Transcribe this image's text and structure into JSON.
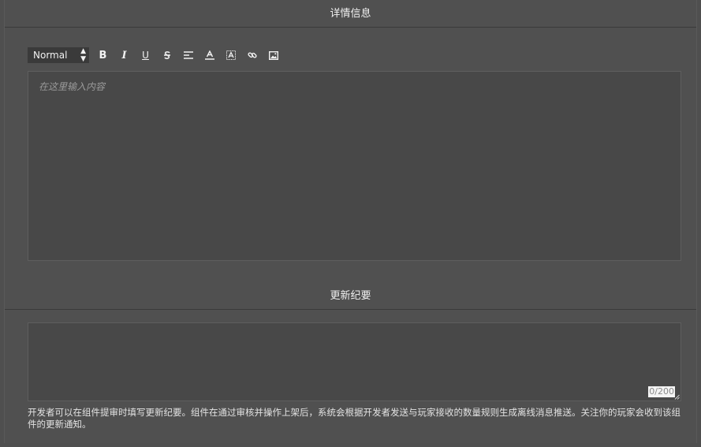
{
  "details": {
    "title": "详情信息",
    "format_select": "Normal",
    "placeholder": "在这里输入内容"
  },
  "toolbar": {
    "icons": [
      "bold-icon",
      "italic-icon",
      "underline-icon",
      "strikethrough-icon",
      "align-icon",
      "font-color-icon",
      "background-color-icon",
      "link-icon",
      "image-icon"
    ],
    "bold_label": "B",
    "italic_label": "I",
    "underline_label": "U"
  },
  "changelog": {
    "title": "更新纪要",
    "value": "",
    "counter": "0/200",
    "hint": "开发者可以在组件提审时填写更新纪要。组件在通过审核并操作上架后，系统会根据开发者发送与玩家接收的数量规则生成离线消息推送。关注你的玩家会收到该组件的更新通知。"
  }
}
